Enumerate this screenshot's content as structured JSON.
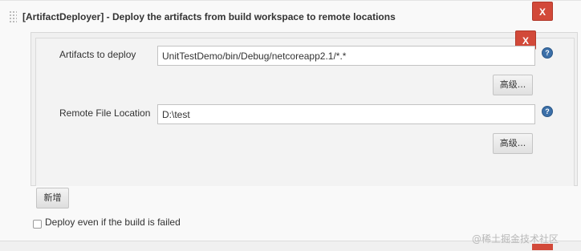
{
  "builder": {
    "title": "[ArtifactDeployer] - Deploy the artifacts from build workspace to remote locations",
    "delete_label": "X"
  },
  "entry": {
    "delete_label": "X",
    "artifacts": {
      "label": "Artifacts to deploy",
      "value": "UnitTestDemo/bin/Debug/netcoreapp2.1/*.*",
      "advanced_label": "高级..."
    },
    "remote": {
      "label": "Remote File Location",
      "value": "D:\\test",
      "advanced_label": "高级..."
    },
    "help_icon": "question-mark"
  },
  "add_button_label": "新增",
  "failed_build_checkbox": {
    "label": "Deploy even if the build is failed",
    "checked": false
  },
  "watermark": "@稀土掘金技术社区",
  "colors": {
    "delete_red": "#d24939",
    "help_blue": "#3b6fa8",
    "panel_bg": "#f9f9f9"
  }
}
